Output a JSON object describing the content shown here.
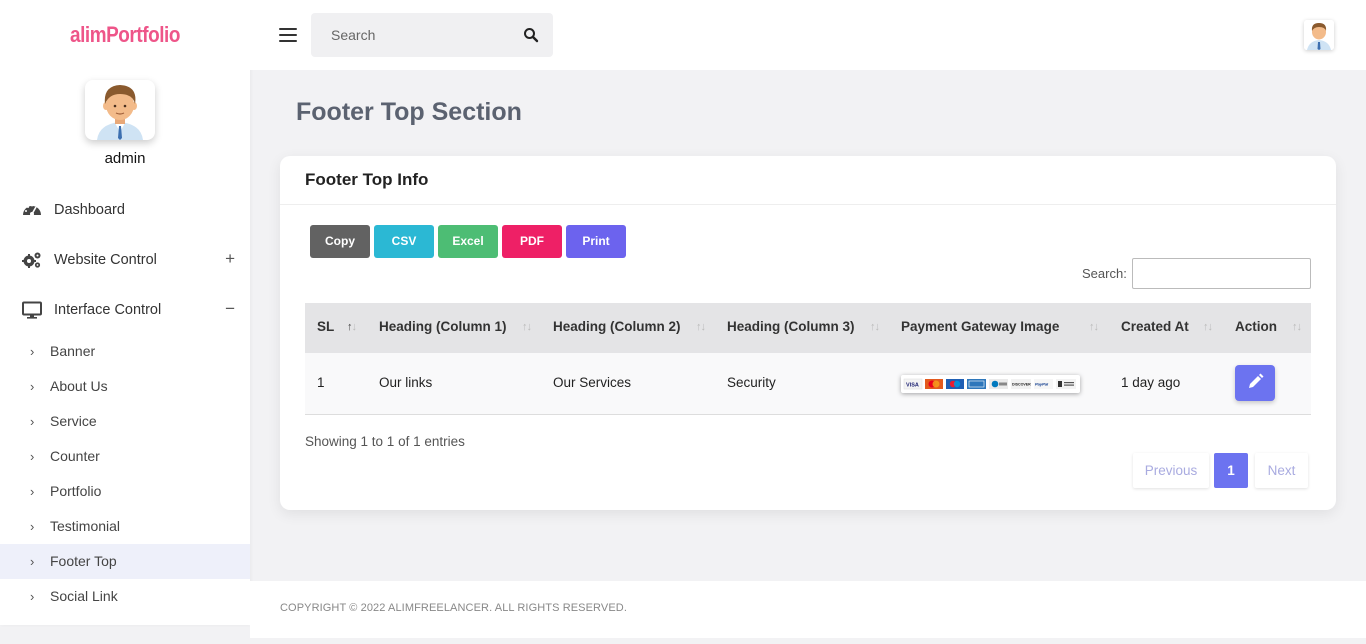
{
  "brand": "alimPortfolio",
  "user": {
    "name": "admin"
  },
  "sidebar": {
    "main_items": [
      {
        "label": "Dashboard",
        "icon": "gauge-icon",
        "sign": ""
      },
      {
        "label": "Website Control",
        "icon": "gears-icon",
        "sign": "+"
      },
      {
        "label": "Interface Control",
        "icon": "monitor-icon",
        "sign": "−"
      }
    ],
    "sub_items": [
      {
        "label": "Banner"
      },
      {
        "label": "About Us"
      },
      {
        "label": "Service"
      },
      {
        "label": "Counter"
      },
      {
        "label": "Portfolio"
      },
      {
        "label": "Testimonial"
      },
      {
        "label": "Footer Top",
        "active": true
      },
      {
        "label": "Social Link"
      }
    ]
  },
  "topbar": {
    "search_placeholder": "Search"
  },
  "page": {
    "title": "Footer Top Section"
  },
  "card": {
    "title": "Footer Top Info",
    "buttons": [
      {
        "label": "Copy",
        "color": "#626262"
      },
      {
        "label": "CSV",
        "color": "#2bb8d4"
      },
      {
        "label": "Excel",
        "color": "#4dbd74"
      },
      {
        "label": "PDF",
        "color": "#ee2066"
      },
      {
        "label": "Print",
        "color": "#6c63ee"
      }
    ],
    "search_label": "Search:",
    "columns": [
      "SL",
      "Heading (Column 1)",
      "Heading (Column 2)",
      "Heading (Column 3)",
      "Payment Gateway Image",
      "Created At",
      "Action"
    ],
    "rows": [
      {
        "sl": "1",
        "col1": "Our links",
        "col2": "Our Services",
        "col3": "Security",
        "created_at": "1 day ago"
      }
    ],
    "info": "Showing 1 to 1 of 1 entries",
    "pagination": {
      "previous": "Previous",
      "current": "1",
      "next": "Next"
    }
  },
  "footer": {
    "text": "COPYRIGHT © 2022 ALIMFREELANCER. ALL RIGHTS RESERVED."
  }
}
